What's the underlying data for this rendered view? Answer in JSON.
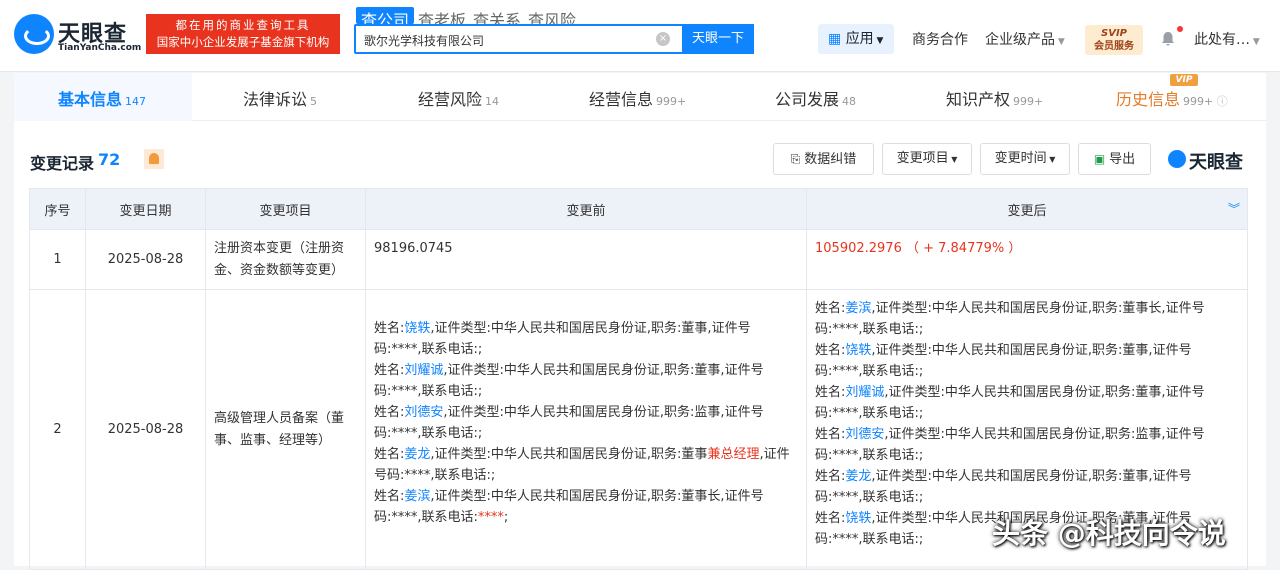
{
  "brand": {
    "name": "天眼查",
    "domain": "TianYanCha.com",
    "slogan1": "都在用的商业查询工具",
    "slogan2": "国家中小企业发展子基金旗下机构"
  },
  "search": {
    "tabs": [
      "查公司",
      "查老板",
      "查关系",
      "查风险"
    ],
    "value": "歌尔光学科技有限公司",
    "button": "天眼一下"
  },
  "topnav": {
    "apps": "应用",
    "coop": "商务合作",
    "enterprise": "企业级产品",
    "svip_line1": "SVIP",
    "svip_line2": "会员服务",
    "user": "此处有…"
  },
  "tabs": [
    {
      "label": "基本信息",
      "count": "147"
    },
    {
      "label": "法律诉讼",
      "count": "5"
    },
    {
      "label": "经营风险",
      "count": "14"
    },
    {
      "label": "经营信息",
      "count": "999+"
    },
    {
      "label": "公司发展",
      "count": "48"
    },
    {
      "label": "知识产权",
      "count": "999+"
    },
    {
      "label": "历史信息",
      "count": "999+"
    }
  ],
  "vip_badge": "VIP",
  "section": {
    "title": "变更记录",
    "count": "72"
  },
  "toolbar": {
    "correction": "数据纠错",
    "item_filter": "变更项目",
    "time_filter": "变更时间",
    "export": "导出",
    "logo": "天眼查"
  },
  "table": {
    "headers": [
      "序号",
      "变更日期",
      "变更项目",
      "变更前",
      "变更后"
    ],
    "rows": [
      {
        "index": "1",
        "date": "2025-08-28",
        "item": "注册资本变更（注册资金、资金数额等变更）",
        "before": "98196.0745",
        "after": "105902.2976 （ + 7.84779% ）"
      },
      {
        "index": "2",
        "date": "2025-08-28",
        "item": "高级管理人员备案（董事、监事、经理等）",
        "before": [
          {
            "name": "饶轶",
            "rest": ",证件类型:中华人民共和国居民身份证,职务:董事,证件号码:****,联系电话:;"
          },
          {
            "name": "刘耀诚",
            "rest": ",证件类型:中华人民共和国居民身份证,职务:董事,证件号码:****,联系电话:;"
          },
          {
            "name": "刘德安",
            "rest": ",证件类型:中华人民共和国居民身份证,职务:监事,证件号码:****,联系电话:;"
          },
          {
            "name": "姜龙",
            "rest": ",证件类型:中华人民共和国居民身份证,职务:董事",
            "extra": "兼总经理",
            "rest2": ",证件号码:****,联系电话:;"
          },
          {
            "name": "姜滨",
            "rest": ",证件类型:中华人民共和国居民身份证,职务:董事长,证件号码:****,联系电话:",
            "extra": "****",
            "rest2": ";"
          }
        ],
        "after": [
          {
            "name": "姜滨",
            "rest": ",证件类型:中华人民共和国居民身份证,职务:董事长,证件号码:****,联系电话:;"
          },
          {
            "name": "饶轶",
            "rest": ",证件类型:中华人民共和国居民身份证,职务:董事,证件号码:****,联系电话:;"
          },
          {
            "name": "刘耀诚",
            "rest": ",证件类型:中华人民共和国居民身份证,职务:董事,证件号码:****,联系电话:;"
          },
          {
            "name": "刘德安",
            "rest": ",证件类型:中华人民共和国居民身份证,职务:监事,证件号码:****,联系电话:;"
          },
          {
            "name": "姜龙",
            "rest": ",证件类型:中华人民共和国居民身份证,职务:董事,证件号码:****,联系电话:;"
          },
          {
            "name": "饶轶",
            "rest": ",证件类型:中华人民共和国居民身份证,职务:董事,证件号码:****,联系电话:;"
          }
        ]
      }
    ]
  },
  "watermark": "头条 @科技向令说"
}
